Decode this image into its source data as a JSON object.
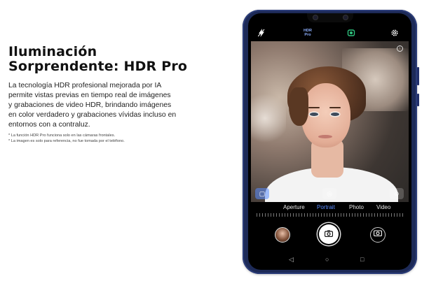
{
  "headline": {
    "line1": "Iluminación",
    "line2": "Sorprendente: HDR Pro"
  },
  "body": {
    "line1": "La tecnología HDR profesional mejorada por IA",
    "line2": "permite vistas previas en tiempo real de imágenes",
    "line3": "y grabaciones de video HDR, brindando imágenes",
    "line4": "en color verdadero y grabaciones vívidas incluso en",
    "line5": "entornos con a contraluz."
  },
  "notes": {
    "note1": "* La función HDR Pro funciona solo en las cámaras frontales.",
    "note2": "* La imagen es solo para referencia, no fue tomada por el teléfono."
  },
  "phone": {
    "hdr_line1": "HDR",
    "hdr_line2": "Pro",
    "modes": [
      "Aperture",
      "Portrait",
      "Photo",
      "Video"
    ],
    "active_mode": "Portrait",
    "colors": {
      "frame": "#1d2a57",
      "accent": "#5b8cff",
      "ai_icon": "#2ec27e"
    },
    "icons": {
      "flash": "flash-icon",
      "ai": "ai-mode-icon",
      "settings": "gear-icon",
      "filter": "filter-icon",
      "aperture": "aperture-icon",
      "beauty": "beauty-icon",
      "shutter": "camera-icon",
      "switch": "switch-camera-icon",
      "back": "back-icon",
      "home": "home-icon",
      "recents": "recents-icon"
    }
  }
}
